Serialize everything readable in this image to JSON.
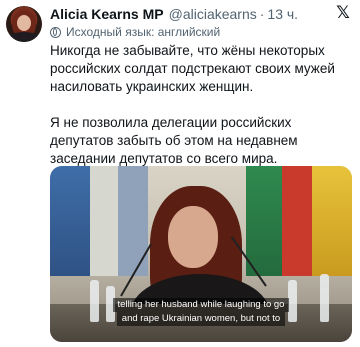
{
  "author": {
    "name": "Alicia Kearns MP",
    "handle": "@aliciakearns",
    "separator": "·",
    "time": "13 ч."
  },
  "translation": {
    "label": "Исходный язык: английский"
  },
  "tweet": {
    "paragraph1": "Никогда не забывайте, что жёны некоторых российских солдат подстрекают своих мужей насиловать украинских женщин.",
    "paragraph2": "Я не позволила делегации российских депутатов забыть об этом на недавнем заседании депутатов со всего мира."
  },
  "media": {
    "subtitle_line1": "telling her husband while laughing to go",
    "subtitle_line2": "and rape Ukrainian women, but not to"
  },
  "icons": {
    "platform": "x-logo-icon",
    "translation": "globe-icon"
  },
  "colors": {
    "text": "#0f1419",
    "secondary": "#536471"
  }
}
